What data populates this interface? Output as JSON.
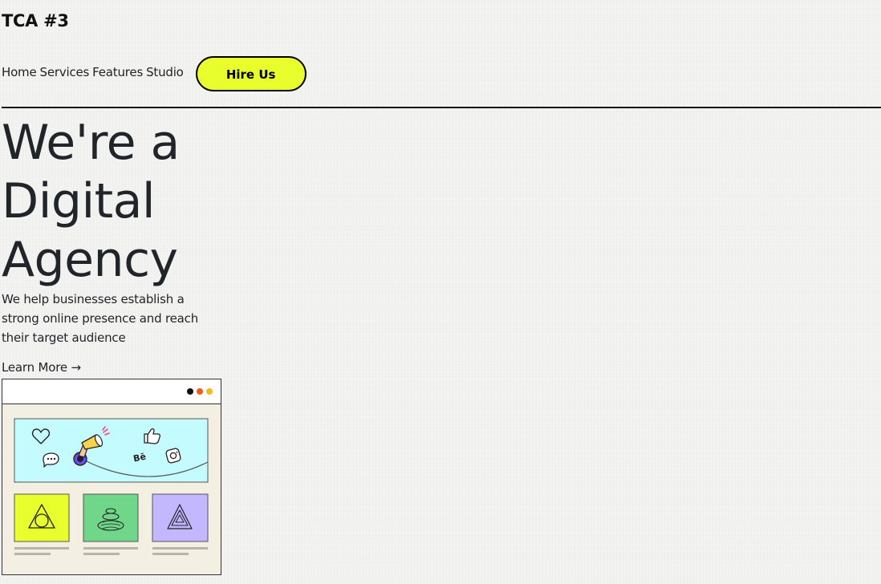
{
  "header": {
    "brand": "TCA #3"
  },
  "nav": {
    "items": [
      {
        "label": "Home"
      },
      {
        "label": "Services"
      },
      {
        "label": "Features"
      },
      {
        "label": "Studio"
      }
    ],
    "cta_label": "Hire Us"
  },
  "hero": {
    "title_lines": [
      "We're a",
      "Digital",
      "Agency"
    ],
    "description": "We help businesses establish a strong online presence and reach their target audience",
    "link_label": "Learn More →"
  },
  "illustration": {
    "social_label": "Bē"
  },
  "colors": {
    "accent_yellow": "#e9ff2d",
    "sky": "#c4fbff",
    "card_green": "#6fd68a",
    "card_lavender": "#c3b8ff",
    "panel_beige": "#f3efe2"
  }
}
